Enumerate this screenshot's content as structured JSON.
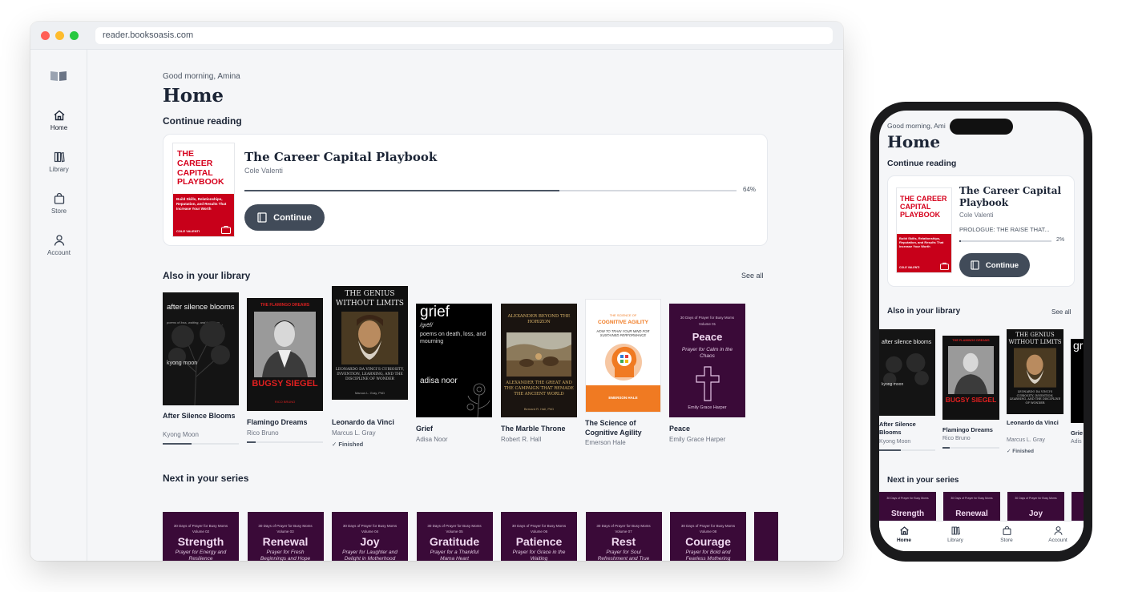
{
  "browser": {
    "url": "reader.booksoasis.com"
  },
  "sidebar": {
    "items": [
      {
        "label": "Home",
        "icon": "home-icon",
        "active": true
      },
      {
        "label": "Library",
        "icon": "library-icon",
        "active": false
      },
      {
        "label": "Store",
        "icon": "bag-icon",
        "active": false
      },
      {
        "label": "Account",
        "icon": "person-icon",
        "active": false
      }
    ]
  },
  "home": {
    "greeting": "Good morning, Amina",
    "title": "Home"
  },
  "continue_reading": {
    "heading": "Continue reading",
    "book": {
      "title": "The Career Capital Playbook",
      "author": "Cole Valenti",
      "progress_percent": 64,
      "progress_label": "64%",
      "cover_title": "THE CAREER CAPITAL PLAYBOOK",
      "cover_subtitle": "Build Skills, Relationships, Reputation, and Results That Increase Your Worth",
      "cover_author": "COLE VALENTI"
    },
    "button_label": "Continue"
  },
  "library": {
    "heading": "Also in your library",
    "see_all": "See all",
    "books": [
      {
        "title": "After Silence Blooms",
        "author": "Kyong Moon",
        "progress": 0.38,
        "cover_title": "after silence blooms",
        "cover_sub": "poems of loss, waiting, and letting go",
        "cover_author": "kyong moon"
      },
      {
        "title": "Flamingo Dreams",
        "author": "Rico Bruno",
        "progress": 0.12,
        "cover_title": "BUGSY SIEGEL",
        "cover_top": "THE FLAMINGO DREAMS",
        "cover_author": "RICO BRUNO"
      },
      {
        "title": "Leonardo da Vinci",
        "author": "Marcus L. Gray",
        "status": "Finished",
        "cover_title": "THE GENIUS WITHOUT LIMITS",
        "cover_sub": "LEONARDO DA VINCI'S CURIOSITY, INVENTION, LEARNING, AND THE DISCIPLINE OF WONDER",
        "cover_author": "Marcus L. Gray, PhD"
      },
      {
        "title": "Grief",
        "author": "Adisa Noor",
        "cover_title": "grief",
        "cover_phon": "/grēf/",
        "cover_sub": "poems on death, loss, and mourning",
        "cover_author": "adisa noor"
      },
      {
        "title": "The Marble Throne",
        "author": "Robert R. Hall",
        "cover_title": "ALEXANDER BEYOND THE HORIZON",
        "cover_sub": "ALEXANDER THE GREAT AND THE CAMPAIGN THAT REMADE THE ANCIENT WORLD",
        "cover_author": "Bernard R. Hall, PhD"
      },
      {
        "title": "The Science of Cognitive Agility",
        "author": "Emerson Hale",
        "cover_top": "THE SCIENCE OF",
        "cover_title": "COGNITIVE AGILITY",
        "cover_sub": "HOW TO TRAIN YOUR MIND FOR SUSTAINED PERFORMANCE",
        "cover_author": "EMERSON HALE"
      },
      {
        "title": "Peace",
        "author": "Emily Grace Harper",
        "cover_top": "30 Days of Prayer for Busy Moms",
        "cover_vol": "Volume 01",
        "cover_title": "Peace",
        "cover_sub": "Prayer for Calm in the Chaos",
        "cover_author": "Emily Grace Harper"
      }
    ]
  },
  "series": {
    "heading": "Next in your series",
    "books": [
      {
        "vol": "Volume 02",
        "title": "Strength",
        "sub": "Prayer for Energy and Resilience"
      },
      {
        "vol": "Volume 03",
        "title": "Renewal",
        "sub": "Prayer for Fresh Beginnings and Hope"
      },
      {
        "vol": "Volume 04",
        "title": "Joy",
        "sub": "Prayer for Laughter and Delight in Motherhood"
      },
      {
        "vol": "Volume 05",
        "title": "Gratitude",
        "sub": "Prayer for a Thankful Mama Heart"
      },
      {
        "vol": "Volume 06",
        "title": "Patience",
        "sub": "Prayer for Grace in the Waiting"
      },
      {
        "vol": "Volume 07",
        "title": "Rest",
        "sub": "Prayer for Soul Refreshment and True Sabbath"
      },
      {
        "vol": "Volume 08",
        "title": "Courage",
        "sub": "Prayer for Bold and Fearless Mothering"
      }
    ],
    "series_label": "30 Days of Prayer for Busy Moms"
  },
  "phone": {
    "greeting": "Good morning, Ami",
    "title": "Home",
    "continue_heading": "Continue reading",
    "book_title": "The Career Capital Playbook",
    "book_author": "Cole Valenti",
    "chapter": "PROLOGUE: THE RAISE THAT...",
    "progress_percent": 2,
    "progress_label": "2%",
    "button_label": "Continue",
    "library_heading": "Also in your library",
    "see_all": "See all",
    "books": [
      {
        "title": "After Silence Blooms",
        "author": "Kyong Moon",
        "progress": 0.38
      },
      {
        "title": "Flamingo Dreams",
        "author": "Rico Bruno",
        "progress": 0.12
      },
      {
        "title": "Leonardo da Vinci",
        "author": "Marcus L. Gray",
        "status": "Finished"
      },
      {
        "title": "Grie",
        "author": "Adis"
      }
    ],
    "series_heading": "Next in your series",
    "series_titles": [
      "Strength",
      "Renewal",
      "Joy"
    ],
    "tabs": [
      "Home",
      "Library",
      "Store",
      "Account"
    ]
  },
  "colors": {
    "accent": "#414b59",
    "purple_cover": "#3a0a38",
    "red_cover": "#d6001c"
  }
}
